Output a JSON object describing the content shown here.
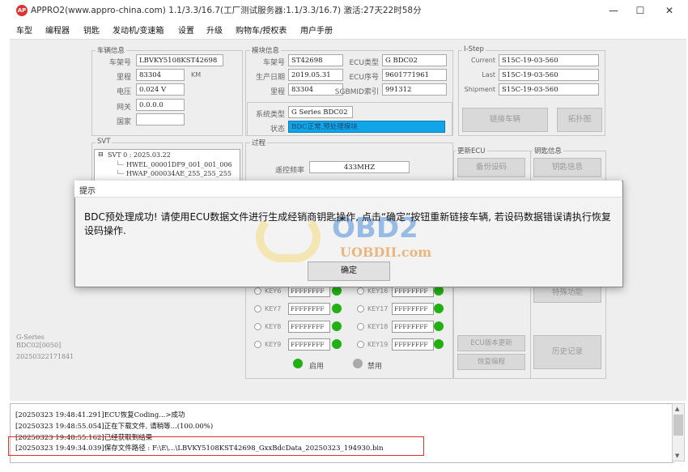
{
  "window": {
    "title": "APPRO2(www.appro-china.com)  1.1/3.3/16.7(工厂测试服务器:1.1/3.3/16.7)  激活:27天22时58分",
    "logo_text": "AP",
    "buttons": {
      "minimize": "—",
      "maximize": "☐",
      "close": "✕"
    }
  },
  "menu": [
    "车型",
    "编程器",
    "钥匙",
    "发动机/变速箱",
    "设置",
    "升级",
    "购物车/授权表",
    "用户手册"
  ],
  "vehicle_info": {
    "group_label": "车辆信息",
    "vin_label": "车架号",
    "vin": "LBVKY5108KST42698",
    "mileage_label": "里程",
    "mileage": "83304",
    "mileage_unit": "KM",
    "voltage_label": "电压",
    "voltage": "0.024 V",
    "gateway_label": "网关",
    "gateway": "0.0.0.0",
    "country_label": "国家",
    "country": ""
  },
  "module_info": {
    "group_label": "模块信息",
    "vin_label": "车架号",
    "vin": "ST42698",
    "ecu_type_label": "ECU类型",
    "ecu_type": "G BDC02",
    "prod_date_label": "生产日期",
    "prod_date": "2019.05.31",
    "ecu_serial_label": "ECU序号",
    "ecu_serial": "9601771961",
    "mileage_label": "里程",
    "mileage": "83304",
    "sgbmid_label": "SGBMID索引",
    "sgbmid": "991312",
    "system_type_label": "系统类型",
    "system_type": "G Series BDC02",
    "status_label": "状态",
    "status": "BDC正常,预处理模块"
  },
  "istep": {
    "group_label": "I-Step",
    "current_label": "Current",
    "current": "S15C-19-03-560",
    "last_label": "Last",
    "last": "S15C-19-03-560",
    "shipment_label": "Shipment",
    "shipment": "S15C-19-03-560"
  },
  "right_buttons": {
    "connect": "链接车辆",
    "topology": "拓扑图"
  },
  "svt": {
    "group_label": "SVT",
    "root": "SVT 0 : 2025.03.22",
    "children": [
      "HWEL_00001DF9_001_001_006",
      "HWAP_000034AE_255_255_255"
    ]
  },
  "process": {
    "group_label": "过程",
    "remote_freq_label": "遥控频率",
    "remote_freq": "433MHZ"
  },
  "update_ecu": {
    "group_label": "更新ECU",
    "backup_btn": "备份设码"
  },
  "key_info": {
    "group_label": "钥匙信息",
    "key_info_btn": "钥匙信息",
    "special_btn": "特殊功能",
    "history_btn": "历史记录"
  },
  "keys_left": [
    {
      "label": "KEY6",
      "value": "FFFFFFFF"
    },
    {
      "label": "KEY7",
      "value": "FFFFFFFF"
    },
    {
      "label": "KEY8",
      "value": "FFFFFFFF"
    },
    {
      "label": "KEY9",
      "value": "FFFFFFFF"
    }
  ],
  "keys_right": [
    {
      "label": "KEY16",
      "value": "FFFFFFFF"
    },
    {
      "label": "KEY17",
      "value": "FFFFFFFF"
    },
    {
      "label": "KEY18",
      "value": "FFFFFFFF"
    },
    {
      "label": "KEY19",
      "value": "FFFFFFFF"
    }
  ],
  "legend": {
    "enabled": "启用",
    "disabled": "禁用"
  },
  "ecu_buttons": {
    "ecu_update": "ECU版本更新",
    "restore_coding": "恢复编程"
  },
  "bottom_left": {
    "line1": "G-Series",
    "line2": "BDC02[0050]",
    "line3": "20250322171841"
  },
  "dialog": {
    "title": "提示",
    "message": "BDC预处理成功! 请使用ECU数据文件进行生成经销商钥匙操作, 点击“确定”按钮重新链接车辆, 若设码数据错误请执行恢复设码操作.",
    "ok": "确定"
  },
  "watermark": {
    "brand": "OBD2",
    "site": "UOBDII.com"
  },
  "log": [
    "[20250323 19:48:41.291]ECU恢复Coding...>成功",
    "[20250323 19:48:55.054]正在下载文件, 请稍等...(100.00%)",
    "[20250323 19:48:55.162]已经获取到结果",
    "[20250323 19:49:34.039]保存文件路径 : F:\\E\\...\\LBVKY5108KST42698_GxxBdcData_20250323_194930.bin"
  ]
}
